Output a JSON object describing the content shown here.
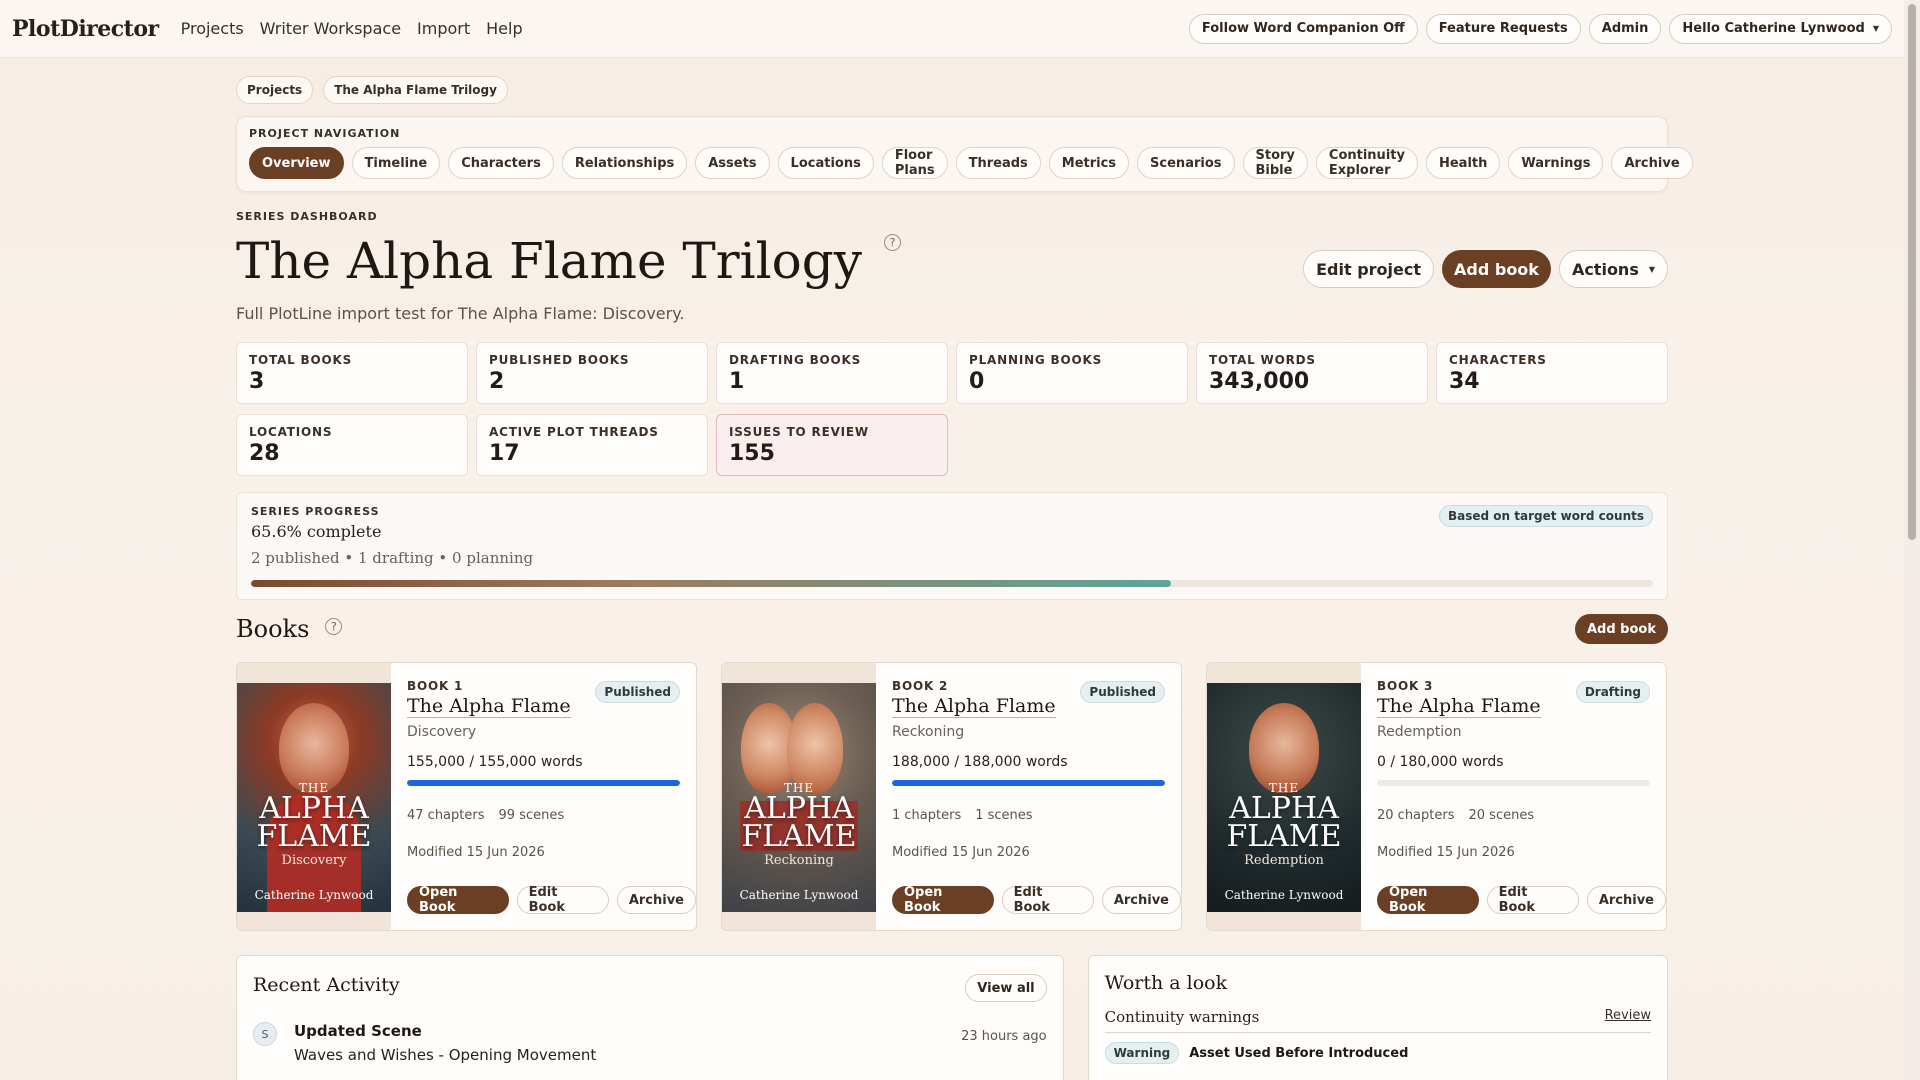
{
  "topnav": {
    "brand": "PlotDirector",
    "links": [
      "Projects",
      "Writer Workspace",
      "Import",
      "Help"
    ],
    "right": {
      "companion": "Follow Word Companion Off",
      "feature_requests": "Feature Requests",
      "admin": "Admin",
      "user": "Hello Catherine Lynwood"
    }
  },
  "breadcrumb": [
    "Projects",
    "The Alpha Flame Trilogy"
  ],
  "project_nav": {
    "heading": "PROJECT NAVIGATION",
    "tabs": [
      "Overview",
      "Timeline",
      "Characters",
      "Relationships",
      "Assets",
      "Locations",
      "Floor Plans",
      "Threads",
      "Metrics",
      "Scenarios",
      "Story Bible",
      "Continuity Explorer",
      "Health",
      "Warnings",
      "Archive"
    ],
    "active_tab": "Overview"
  },
  "dashboard": {
    "eyebrow": "SERIES DASHBOARD",
    "title": "The Alpha Flame Trilogy",
    "help": "?",
    "subtitle": "Full PlotLine import test for The Alpha Flame: Discovery.",
    "actions": {
      "edit": "Edit project",
      "add": "Add book",
      "more": "Actions"
    }
  },
  "stats": [
    {
      "label": "TOTAL BOOKS",
      "value": "3"
    },
    {
      "label": "PUBLISHED BOOKS",
      "value": "2"
    },
    {
      "label": "DRAFTING BOOKS",
      "value": "1"
    },
    {
      "label": "PLANNING BOOKS",
      "value": "0"
    },
    {
      "label": "TOTAL WORDS",
      "value": "343,000"
    },
    {
      "label": "CHARACTERS",
      "value": "34"
    },
    {
      "label": "LOCATIONS",
      "value": "28"
    },
    {
      "label": "ACTIVE PLOT THREADS",
      "value": "17"
    },
    {
      "label": "ISSUES TO REVIEW",
      "value": "155"
    }
  ],
  "progress": {
    "heading": "SERIES PROGRESS",
    "percent_text": "65.6% complete",
    "percent": 65.6,
    "breakdown": "2 published • 1 drafting • 0 planning",
    "badge": "Based on target word counts"
  },
  "books_section": {
    "heading": "Books",
    "help": "?",
    "add": "Add book"
  },
  "books": [
    {
      "num": "BOOK 1",
      "title": "The Alpha Flame",
      "subtitle": "Discovery",
      "status": "Published",
      "words": "155,000 / 155,000 words",
      "progress": 100,
      "chapters": "47 chapters",
      "scenes": "99 scenes",
      "modified": "Modified 15 Jun 2026",
      "cover": {
        "the": "THE",
        "title": "ALPHA FLAME",
        "sub": "Discovery",
        "author": "Catherine Lynwood"
      }
    },
    {
      "num": "BOOK 2",
      "title": "The Alpha Flame",
      "subtitle": "Reckoning",
      "status": "Published",
      "words": "188,000 / 188,000 words",
      "progress": 100,
      "chapters": "1 chapters",
      "scenes": "1 scenes",
      "modified": "Modified 15 Jun 2026",
      "cover": {
        "the": "THE",
        "title": "ALPHA FLAME",
        "sub": "Reckoning",
        "author": "Catherine Lynwood"
      }
    },
    {
      "num": "BOOK 3",
      "title": "The Alpha Flame",
      "subtitle": "Redemption",
      "status": "Drafting",
      "words": "0 / 180,000 words",
      "progress": 0,
      "chapters": "20 chapters",
      "scenes": "20 scenes",
      "modified": "Modified 15 Jun 2026",
      "cover": {
        "the": "THE",
        "title": "ALPHA FLAME",
        "sub": "Redemption",
        "author": "Catherine Lynwood"
      }
    }
  ],
  "book_actions": {
    "open": "Open Book",
    "edit": "Edit Book",
    "archive": "Archive"
  },
  "recent": {
    "heading": "Recent Activity",
    "view_all": "View all",
    "item": {
      "avatar": "S",
      "title": "Updated Scene",
      "sub": "Waves and Wishes - Opening Movement",
      "time": "23 hours ago"
    }
  },
  "worth": {
    "heading": "Worth a look",
    "row_label": "Continuity warnings",
    "row_link": "Review",
    "badge": "Warning",
    "text": "Asset Used Before Introduced"
  },
  "colors": {
    "brand_brown": "#6b3f24",
    "progress_blue": "#1a66e0",
    "teal": "#5ea59a"
  }
}
